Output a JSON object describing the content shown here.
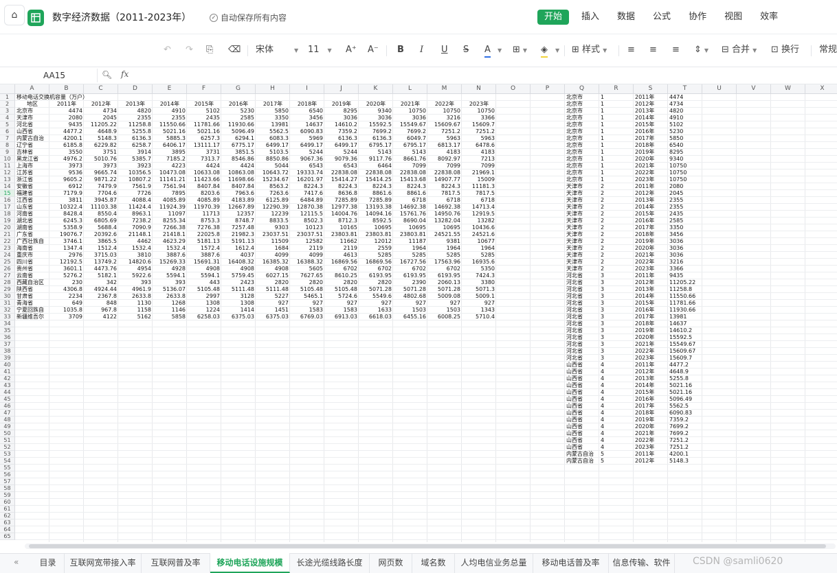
{
  "window": {
    "title": "数字经济数据（2011-2023年）",
    "autosave": "自动保存所有内容"
  },
  "menu": [
    "开始",
    "插入",
    "数据",
    "公式",
    "协作",
    "视图",
    "效率"
  ],
  "toolbar": {
    "font_name": "宋体",
    "font_size": "11",
    "style_label": "样式",
    "merge_label": "合并",
    "wrap_label": "换行",
    "format_label": "常规"
  },
  "formula_bar": {
    "cell_ref": "AA15",
    "formula": ""
  },
  "columns": [
    "A",
    "B",
    "C",
    "D",
    "E",
    "F",
    "G",
    "H",
    "I",
    "J",
    "K",
    "L",
    "M",
    "N",
    "O",
    "P",
    "Q",
    "R",
    "S",
    "T",
    "U",
    "V",
    "W",
    "X"
  ],
  "selected_row": 15,
  "table_title": "移动电话交换机容量（万户）",
  "table_header": [
    "地区",
    "2011年",
    "2012年",
    "2013年",
    "2014年",
    "2015年",
    "2016年",
    "2017年",
    "2018年",
    "2019年",
    "2020年",
    "2021年",
    "2022年",
    "2023年"
  ],
  "table_rows": [
    [
      "北京市",
      "4474",
      "4734",
      "4820",
      "4910",
      "5102",
      "5230",
      "5850",
      "6540",
      "8295",
      "9340",
      "10750",
      "10750",
      "10750"
    ],
    [
      "天津市",
      "2080",
      "2045",
      "2355",
      "2355",
      "2435",
      "2585",
      "3350",
      "3456",
      "3036",
      "3036",
      "3036",
      "3216",
      "3366"
    ],
    [
      "河北省",
      "9435",
      "11205.22",
      "11258.8",
      "11550.66",
      "11781.66",
      "11930.66",
      "13981",
      "14637",
      "14610.2",
      "15592.5",
      "15549.67",
      "15609.67",
      "15609.7"
    ],
    [
      "山西省",
      "4477.2",
      "4648.9",
      "5255.8",
      "5021.16",
      "5021.16",
      "5096.49",
      "5562.5",
      "6090.83",
      "7359.2",
      "7699.2",
      "7699.2",
      "7251.2",
      "7251.2"
    ],
    [
      "内蒙古自治",
      "4200.1",
      "5148.3",
      "6136.3",
      "5885.3",
      "6257.3",
      "6294.1",
      "6083.3",
      "5969",
      "6136.3",
      "6136.3",
      "6049.7",
      "5963",
      "5963"
    ],
    [
      "辽宁省",
      "6185.8",
      "6229.82",
      "6258.7",
      "6406.17",
      "13111.17",
      "6775.17",
      "6499.17",
      "6499.17",
      "6499.17",
      "6795.17",
      "6795.17",
      "6813.17",
      "6478.6"
    ],
    [
      "吉林省",
      "3550",
      "3751",
      "3914",
      "3895",
      "3731",
      "3851.5",
      "5103.5",
      "5244",
      "5244",
      "5143",
      "5143",
      "4183",
      "4183"
    ],
    [
      "黑龙江省",
      "4976.2",
      "5010.76",
      "5385.7",
      "7185.2",
      "7313.7",
      "8546.86",
      "8850.86",
      "9067.36",
      "9079.36",
      "9117.76",
      "8661.76",
      "8092.97",
      "7213"
    ],
    [
      "上海市",
      "3973",
      "3973",
      "3923",
      "4223",
      "4424",
      "4424",
      "5044",
      "6543",
      "6543",
      "6464",
      "7099",
      "7099",
      "7099"
    ],
    [
      "江苏省",
      "9536",
      "9665.74",
      "10356.5",
      "10473.08",
      "10633.08",
      "10863.08",
      "10643.72",
      "19333.74",
      "22838.08",
      "22838.08",
      "22838.08",
      "22838.08",
      "21969.1"
    ],
    [
      "浙江省",
      "9605.2",
      "9871.22",
      "10807.2",
      "11141.21",
      "11423.66",
      "11698.66",
      "15234.67",
      "16201.97",
      "15414.27",
      "15414.25",
      "15413.68",
      "14907.77",
      "15009"
    ],
    [
      "安徽省",
      "6912",
      "7479.9",
      "7561.9",
      "7561.94",
      "8407.84",
      "8407.84",
      "8563.2",
      "8224.3",
      "8224.3",
      "8224.3",
      "8224.3",
      "8224.3",
      "11181.3"
    ],
    [
      "福建省",
      "7179.9",
      "7704.6",
      "7726",
      "7895",
      "8203.6",
      "7963.6",
      "7263.6",
      "7417.6",
      "8636.8",
      "8861.6",
      "8861.6",
      "7817.5",
      "7817.5"
    ],
    [
      "江西省",
      "3811",
      "3945.87",
      "4088.4",
      "4085.89",
      "4085.89",
      "4183.89",
      "6125.89",
      "6484.89",
      "7285.89",
      "7285.89",
      "6718",
      "6718",
      "6718"
    ],
    [
      "山东省",
      "10322.4",
      "11103.38",
      "11424.4",
      "11924.39",
      "11970.39",
      "12667.89",
      "12290.39",
      "12870.38",
      "12977.38",
      "13193.38",
      "14692.38",
      "14692.38",
      "14713.4"
    ],
    [
      "河南省",
      "8428.4",
      "8550.4",
      "8963.1",
      "11097",
      "11713",
      "12357",
      "12239",
      "12115.5",
      "14004.76",
      "14094.16",
      "15761.76",
      "14950.76",
      "12919.5"
    ],
    [
      "湖北省",
      "6245.3",
      "6805.69",
      "7238.2",
      "8255.34",
      "8753.3",
      "8748.7",
      "8833.5",
      "8502.3",
      "8712.3",
      "8592.5",
      "8690.04",
      "13282.04",
      "13282"
    ],
    [
      "湖南省",
      "5358.9",
      "5688.4",
      "7090.9",
      "7266.38",
      "7276.38",
      "7257.48",
      "9303",
      "10123",
      "10165",
      "10695",
      "10695",
      "10695",
      "10436.6"
    ],
    [
      "广东省",
      "19076.7",
      "20392.6",
      "21148.1",
      "21418.1",
      "22025.8",
      "21982.3",
      "23037.51",
      "23037.51",
      "23803.81",
      "23803.81",
      "23803.81",
      "24521.55",
      "24521.6"
    ],
    [
      "广西壮族自",
      "3746.1",
      "3865.5",
      "4462",
      "4623.29",
      "5181.13",
      "5191.13",
      "11509",
      "12582",
      "11662",
      "12012",
      "11187",
      "9381",
      "10677"
    ],
    [
      "海南省",
      "1347.4",
      "1512.4",
      "1532.4",
      "1532.4",
      "1572.4",
      "1612.4",
      "1684",
      "2119",
      "2119",
      "2559",
      "1964",
      "1964",
      "1964"
    ],
    [
      "重庆市",
      "2976",
      "3715.03",
      "3810",
      "3887.6",
      "3887.6",
      "4037",
      "4099",
      "4099",
      "4613",
      "5285",
      "5285",
      "5285",
      "5285"
    ],
    [
      "四川省",
      "12192.5",
      "13749.2",
      "14820.6",
      "15269.33",
      "15691.31",
      "16408.32",
      "16385.32",
      "16388.32",
      "16869.56",
      "16869.56",
      "16727.56",
      "17563.96",
      "16935.6"
    ],
    [
      "贵州省",
      "3601.1",
      "4473.76",
      "4954",
      "4928",
      "4908",
      "4908",
      "4908",
      "5605",
      "6702",
      "6702",
      "6702",
      "6702",
      "5350"
    ],
    [
      "云南省",
      "5276.2",
      "5182.1",
      "5922.6",
      "5594.1",
      "5594.1",
      "5759.45",
      "6027.15",
      "7627.65",
      "8610.25",
      "6193.95",
      "6193.95",
      "6193.95",
      "7424.3"
    ],
    [
      "西藏自治区",
      "230",
      "342",
      "393",
      "393",
      "443",
      "2423",
      "2820",
      "2820",
      "2820",
      "2820",
      "2390",
      "2060.13",
      "3380"
    ],
    [
      "陕西省",
      "4306.8",
      "4924.44",
      "4961.9",
      "5136.07",
      "5105.48",
      "5111.48",
      "5111.48",
      "5105.48",
      "5105.48",
      "5071.28",
      "5071.28",
      "5071.28",
      "5071.3"
    ],
    [
      "甘肃省",
      "2234",
      "2367.8",
      "2633.8",
      "2633.8",
      "2997",
      "3128",
      "5227",
      "5465.1",
      "5724.6",
      "5549.6",
      "4802.68",
      "5009.08",
      "5009.1"
    ],
    [
      "青海省",
      "649",
      "848",
      "1130",
      "1268",
      "1308",
      "1308",
      "927",
      "927",
      "927",
      "927",
      "927",
      "927",
      "927"
    ],
    [
      "宁夏回族自",
      "1035.8",
      "967.8",
      "1158",
      "1146",
      "1224",
      "1414",
      "1451",
      "1583",
      "1583",
      "1633",
      "1503",
      "1503",
      "1343"
    ],
    [
      "新疆维吾尔",
      "3709",
      "4122",
      "5162",
      "5858",
      "6258.03",
      "6375.03",
      "6375.03",
      "6769.03",
      "6913.03",
      "6618.03",
      "6455.16",
      "6008.25",
      "5710.4"
    ]
  ],
  "long_rows": [
    [
      "北京市",
      "1",
      "2011年",
      "4474"
    ],
    [
      "北京市",
      "1",
      "2012年",
      "4734"
    ],
    [
      "北京市",
      "1",
      "2013年",
      "4820"
    ],
    [
      "北京市",
      "1",
      "2014年",
      "4910"
    ],
    [
      "北京市",
      "1",
      "2015年",
      "5102"
    ],
    [
      "北京市",
      "1",
      "2016年",
      "5230"
    ],
    [
      "北京市",
      "1",
      "2017年",
      "5850"
    ],
    [
      "北京市",
      "1",
      "2018年",
      "6540"
    ],
    [
      "北京市",
      "1",
      "2019年",
      "8295"
    ],
    [
      "北京市",
      "1",
      "2020年",
      "9340"
    ],
    [
      "北京市",
      "1",
      "2021年",
      "10750"
    ],
    [
      "北京市",
      "1",
      "2022年",
      "10750"
    ],
    [
      "北京市",
      "1",
      "2023年",
      "10750"
    ],
    [
      "天津市",
      "2",
      "2011年",
      "2080"
    ],
    [
      "天津市",
      "2",
      "2012年",
      "2045"
    ],
    [
      "天津市",
      "2",
      "2013年",
      "2355"
    ],
    [
      "天津市",
      "2",
      "2014年",
      "2355"
    ],
    [
      "天津市",
      "2",
      "2015年",
      "2435"
    ],
    [
      "天津市",
      "2",
      "2016年",
      "2585"
    ],
    [
      "天津市",
      "2",
      "2017年",
      "3350"
    ],
    [
      "天津市",
      "2",
      "2018年",
      "3456"
    ],
    [
      "天津市",
      "2",
      "2019年",
      "3036"
    ],
    [
      "天津市",
      "2",
      "2020年",
      "3036"
    ],
    [
      "天津市",
      "2",
      "2021年",
      "3036"
    ],
    [
      "天津市",
      "2",
      "2022年",
      "3216"
    ],
    [
      "天津市",
      "2",
      "2023年",
      "3366"
    ],
    [
      "河北省",
      "3",
      "2011年",
      "9435"
    ],
    [
      "河北省",
      "3",
      "2012年",
      "11205.22"
    ],
    [
      "河北省",
      "3",
      "2013年",
      "11258.8"
    ],
    [
      "河北省",
      "3",
      "2014年",
      "11550.66"
    ],
    [
      "河北省",
      "3",
      "2015年",
      "11781.66"
    ],
    [
      "河北省",
      "3",
      "2016年",
      "11930.66"
    ],
    [
      "河北省",
      "3",
      "2017年",
      "13981"
    ],
    [
      "河北省",
      "3",
      "2018年",
      "14637"
    ],
    [
      "河北省",
      "3",
      "2019年",
      "14610.2"
    ],
    [
      "河北省",
      "3",
      "2020年",
      "15592.5"
    ],
    [
      "河北省",
      "3",
      "2021年",
      "15549.67"
    ],
    [
      "河北省",
      "3",
      "2022年",
      "15609.67"
    ],
    [
      "河北省",
      "3",
      "2023年",
      "15609.7"
    ],
    [
      "山西省",
      "4",
      "2011年",
      "4477.2"
    ],
    [
      "山西省",
      "4",
      "2012年",
      "4648.9"
    ],
    [
      "山西省",
      "4",
      "2013年",
      "5255.8"
    ],
    [
      "山西省",
      "4",
      "2014年",
      "5021.16"
    ],
    [
      "山西省",
      "4",
      "2015年",
      "5021.16"
    ],
    [
      "山西省",
      "4",
      "2016年",
      "5096.49"
    ],
    [
      "山西省",
      "4",
      "2017年",
      "5562.5"
    ],
    [
      "山西省",
      "4",
      "2018年",
      "6090.83"
    ],
    [
      "山西省",
      "4",
      "2019年",
      "7359.2"
    ],
    [
      "山西省",
      "4",
      "2020年",
      "7699.2"
    ],
    [
      "山西省",
      "4",
      "2021年",
      "7699.2"
    ],
    [
      "山西省",
      "4",
      "2022年",
      "7251.2"
    ],
    [
      "山西省",
      "4",
      "2023年",
      "7251.2"
    ],
    [
      "内蒙古自治",
      "5",
      "2011年",
      "4200.1"
    ],
    [
      "内蒙古自治",
      "5",
      "2012年",
      "5148.3"
    ]
  ],
  "sheet_tabs": [
    "目录",
    "互联网宽带接入率",
    "互联网普及率",
    "移动电话设施规模",
    "长途光缆线路长度",
    "网页数",
    "域名数",
    "人均电信业务总量",
    "移动电话普及率",
    "信息传输、软件"
  ],
  "active_tab": 3,
  "watermark": "CSDN @samli0620"
}
